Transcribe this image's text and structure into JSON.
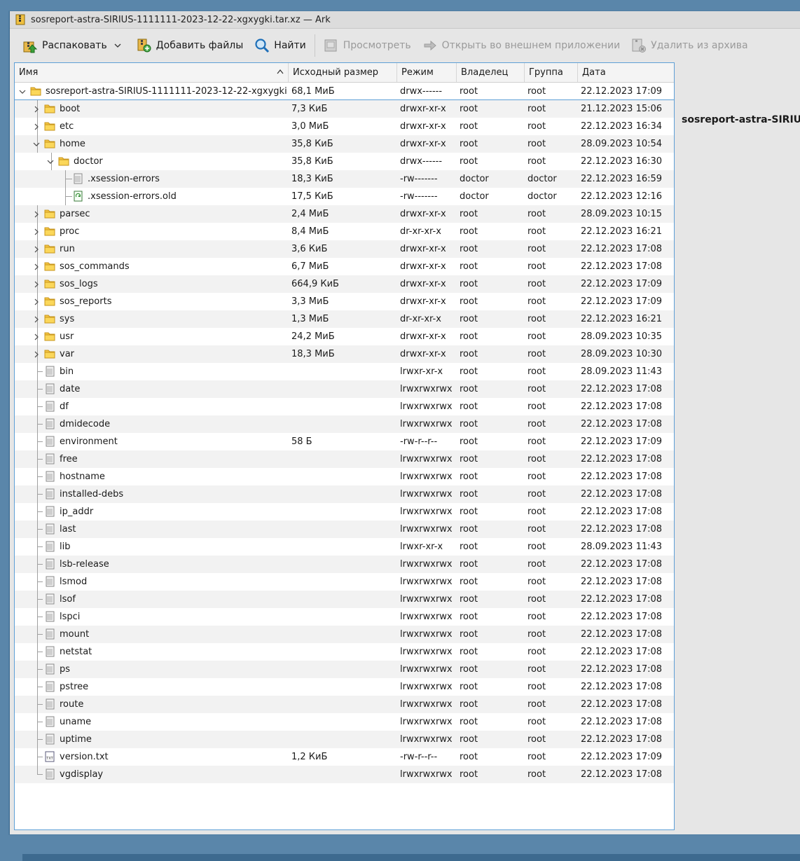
{
  "window": {
    "title": "sosreport-astra-SIRIUS-1111111-2023-12-22-xgxygki.tar.xz — Ark"
  },
  "toolbar": {
    "extract": "Распаковать",
    "add_files": "Добавить файлы",
    "find": "Найти",
    "preview": "Просмотреть",
    "open_external": "Открыть во внешнем приложении",
    "delete": "Удалить из архива"
  },
  "columns": {
    "name": "Имя",
    "size": "Исходный размер",
    "mode": "Режим",
    "owner": "Владелец",
    "group": "Группа",
    "date": "Дата"
  },
  "rows": [
    {
      "depth": 0,
      "type": "folder",
      "exp": "open",
      "name": "sosreport-astra-SIRIUS-1111111-2023-12-22-xgxygki",
      "size": "68,1 МиБ",
      "mode": "drwx------",
      "owner": "root",
      "group": "root",
      "date": "22.12.2023 17:09"
    },
    {
      "depth": 1,
      "type": "folder",
      "exp": "closed",
      "name": "boot",
      "size": "7,3 КиБ",
      "mode": "drwxr-xr-x",
      "owner": "root",
      "group": "root",
      "date": "21.12.2023 15:06"
    },
    {
      "depth": 1,
      "type": "folder",
      "exp": "closed",
      "name": "etc",
      "size": "3,0 МиБ",
      "mode": "drwxr-xr-x",
      "owner": "root",
      "group": "root",
      "date": "22.12.2023 16:34"
    },
    {
      "depth": 1,
      "type": "folder",
      "exp": "open",
      "name": "home",
      "size": "35,8 КиБ",
      "mode": "drwxr-xr-x",
      "owner": "root",
      "group": "root",
      "date": "28.09.2023 10:54"
    },
    {
      "depth": 2,
      "type": "folder",
      "exp": "open",
      "name": "doctor",
      "size": "35,8 КиБ",
      "mode": "drwx------",
      "owner": "root",
      "group": "root",
      "date": "22.12.2023 16:30"
    },
    {
      "depth": 3,
      "type": "file",
      "exp": "none",
      "name": ".xsession-errors",
      "size": "18,3 КиБ",
      "mode": "-rw-------",
      "owner": "doctor",
      "group": "doctor",
      "date": "22.12.2023 16:59"
    },
    {
      "depth": 3,
      "type": "file-green",
      "exp": "none",
      "name": ".xsession-errors.old",
      "size": "17,5 КиБ",
      "mode": "-rw-------",
      "owner": "doctor",
      "group": "doctor",
      "date": "22.12.2023 12:16"
    },
    {
      "depth": 1,
      "type": "folder",
      "exp": "closed",
      "name": "parsec",
      "size": "2,4 МиБ",
      "mode": "drwxr-xr-x",
      "owner": "root",
      "group": "root",
      "date": "28.09.2023 10:15"
    },
    {
      "depth": 1,
      "type": "folder",
      "exp": "closed",
      "name": "proc",
      "size": "8,4 МиБ",
      "mode": "dr-xr-xr-x",
      "owner": "root",
      "group": "root",
      "date": "22.12.2023 16:21"
    },
    {
      "depth": 1,
      "type": "folder",
      "exp": "closed",
      "name": "run",
      "size": "3,6 КиБ",
      "mode": "drwxr-xr-x",
      "owner": "root",
      "group": "root",
      "date": "22.12.2023 17:08"
    },
    {
      "depth": 1,
      "type": "folder",
      "exp": "closed",
      "name": "sos_commands",
      "size": "6,7 МиБ",
      "mode": "drwxr-xr-x",
      "owner": "root",
      "group": "root",
      "date": "22.12.2023 17:08"
    },
    {
      "depth": 1,
      "type": "folder",
      "exp": "closed",
      "name": "sos_logs",
      "size": "664,9 КиБ",
      "mode": "drwxr-xr-x",
      "owner": "root",
      "group": "root",
      "date": "22.12.2023 17:09"
    },
    {
      "depth": 1,
      "type": "folder",
      "exp": "closed",
      "name": "sos_reports",
      "size": "3,3 МиБ",
      "mode": "drwxr-xr-x",
      "owner": "root",
      "group": "root",
      "date": "22.12.2023 17:09"
    },
    {
      "depth": 1,
      "type": "folder",
      "exp": "closed",
      "name": "sys",
      "size": "1,3 МиБ",
      "mode": "dr-xr-xr-x",
      "owner": "root",
      "group": "root",
      "date": "22.12.2023 16:21"
    },
    {
      "depth": 1,
      "type": "folder",
      "exp": "closed",
      "name": "usr",
      "size": "24,2 МиБ",
      "mode": "drwxr-xr-x",
      "owner": "root",
      "group": "root",
      "date": "28.09.2023 10:35"
    },
    {
      "depth": 1,
      "type": "folder",
      "exp": "closed",
      "name": "var",
      "size": "18,3 МиБ",
      "mode": "drwxr-xr-x",
      "owner": "root",
      "group": "root",
      "date": "28.09.2023 10:30"
    },
    {
      "depth": 1,
      "type": "file",
      "exp": "none",
      "name": "bin",
      "size": "",
      "mode": "lrwxr-xr-x",
      "owner": "root",
      "group": "root",
      "date": "28.09.2023 11:43"
    },
    {
      "depth": 1,
      "type": "file",
      "exp": "none",
      "name": "date",
      "size": "",
      "mode": "lrwxrwxrwx",
      "owner": "root",
      "group": "root",
      "date": "22.12.2023 17:08"
    },
    {
      "depth": 1,
      "type": "file",
      "exp": "none",
      "name": "df",
      "size": "",
      "mode": "lrwxrwxrwx",
      "owner": "root",
      "group": "root",
      "date": "22.12.2023 17:08"
    },
    {
      "depth": 1,
      "type": "file",
      "exp": "none",
      "name": "dmidecode",
      "size": "",
      "mode": "lrwxrwxrwx",
      "owner": "root",
      "group": "root",
      "date": "22.12.2023 17:08"
    },
    {
      "depth": 1,
      "type": "file",
      "exp": "none",
      "name": "environment",
      "size": "58 Б",
      "mode": "-rw-r--r--",
      "owner": "root",
      "group": "root",
      "date": "22.12.2023 17:09"
    },
    {
      "depth": 1,
      "type": "file",
      "exp": "none",
      "name": "free",
      "size": "",
      "mode": "lrwxrwxrwx",
      "owner": "root",
      "group": "root",
      "date": "22.12.2023 17:08"
    },
    {
      "depth": 1,
      "type": "file",
      "exp": "none",
      "name": "hostname",
      "size": "",
      "mode": "lrwxrwxrwx",
      "owner": "root",
      "group": "root",
      "date": "22.12.2023 17:08"
    },
    {
      "depth": 1,
      "type": "file",
      "exp": "none",
      "name": "installed-debs",
      "size": "",
      "mode": "lrwxrwxrwx",
      "owner": "root",
      "group": "root",
      "date": "22.12.2023 17:08"
    },
    {
      "depth": 1,
      "type": "file",
      "exp": "none",
      "name": "ip_addr",
      "size": "",
      "mode": "lrwxrwxrwx",
      "owner": "root",
      "group": "root",
      "date": "22.12.2023 17:08"
    },
    {
      "depth": 1,
      "type": "file",
      "exp": "none",
      "name": "last",
      "size": "",
      "mode": "lrwxrwxrwx",
      "owner": "root",
      "group": "root",
      "date": "22.12.2023 17:08"
    },
    {
      "depth": 1,
      "type": "file",
      "exp": "none",
      "name": "lib",
      "size": "",
      "mode": "lrwxr-xr-x",
      "owner": "root",
      "group": "root",
      "date": "28.09.2023 11:43"
    },
    {
      "depth": 1,
      "type": "file",
      "exp": "none",
      "name": "lsb-release",
      "size": "",
      "mode": "lrwxrwxrwx",
      "owner": "root",
      "group": "root",
      "date": "22.12.2023 17:08"
    },
    {
      "depth": 1,
      "type": "file",
      "exp": "none",
      "name": "lsmod",
      "size": "",
      "mode": "lrwxrwxrwx",
      "owner": "root",
      "group": "root",
      "date": "22.12.2023 17:08"
    },
    {
      "depth": 1,
      "type": "file",
      "exp": "none",
      "name": "lsof",
      "size": "",
      "mode": "lrwxrwxrwx",
      "owner": "root",
      "group": "root",
      "date": "22.12.2023 17:08"
    },
    {
      "depth": 1,
      "type": "file",
      "exp": "none",
      "name": "lspci",
      "size": "",
      "mode": "lrwxrwxrwx",
      "owner": "root",
      "group": "root",
      "date": "22.12.2023 17:08"
    },
    {
      "depth": 1,
      "type": "file",
      "exp": "none",
      "name": "mount",
      "size": "",
      "mode": "lrwxrwxrwx",
      "owner": "root",
      "group": "root",
      "date": "22.12.2023 17:08"
    },
    {
      "depth": 1,
      "type": "file",
      "exp": "none",
      "name": "netstat",
      "size": "",
      "mode": "lrwxrwxrwx",
      "owner": "root",
      "group": "root",
      "date": "22.12.2023 17:08"
    },
    {
      "depth": 1,
      "type": "file",
      "exp": "none",
      "name": "ps",
      "size": "",
      "mode": "lrwxrwxrwx",
      "owner": "root",
      "group": "root",
      "date": "22.12.2023 17:08"
    },
    {
      "depth": 1,
      "type": "file",
      "exp": "none",
      "name": "pstree",
      "size": "",
      "mode": "lrwxrwxrwx",
      "owner": "root",
      "group": "root",
      "date": "22.12.2023 17:08"
    },
    {
      "depth": 1,
      "type": "file",
      "exp": "none",
      "name": "route",
      "size": "",
      "mode": "lrwxrwxrwx",
      "owner": "root",
      "group": "root",
      "date": "22.12.2023 17:08"
    },
    {
      "depth": 1,
      "type": "file",
      "exp": "none",
      "name": "uname",
      "size": "",
      "mode": "lrwxrwxrwx",
      "owner": "root",
      "group": "root",
      "date": "22.12.2023 17:08"
    },
    {
      "depth": 1,
      "type": "file",
      "exp": "none",
      "name": "uptime",
      "size": "",
      "mode": "lrwxrwxrwx",
      "owner": "root",
      "group": "root",
      "date": "22.12.2023 17:08"
    },
    {
      "depth": 1,
      "type": "txt",
      "exp": "none",
      "name": "version.txt",
      "size": "1,2 КиБ",
      "mode": "-rw-r--r--",
      "owner": "root",
      "group": "root",
      "date": "22.12.2023 17:09"
    },
    {
      "depth": 1,
      "type": "file",
      "exp": "none",
      "name": "vgdisplay",
      "size": "",
      "mode": "lrwxrwxrwx",
      "owner": "root",
      "group": "root",
      "date": "22.12.2023 17:08"
    }
  ],
  "side_panel": {
    "title": "sosreport-astra-SIRIUS"
  },
  "colors": {
    "desktop": "#5a86aa",
    "window_bg": "#e6e6e6",
    "selection_border": "#5e9fd6",
    "folder": "#f5c542"
  }
}
